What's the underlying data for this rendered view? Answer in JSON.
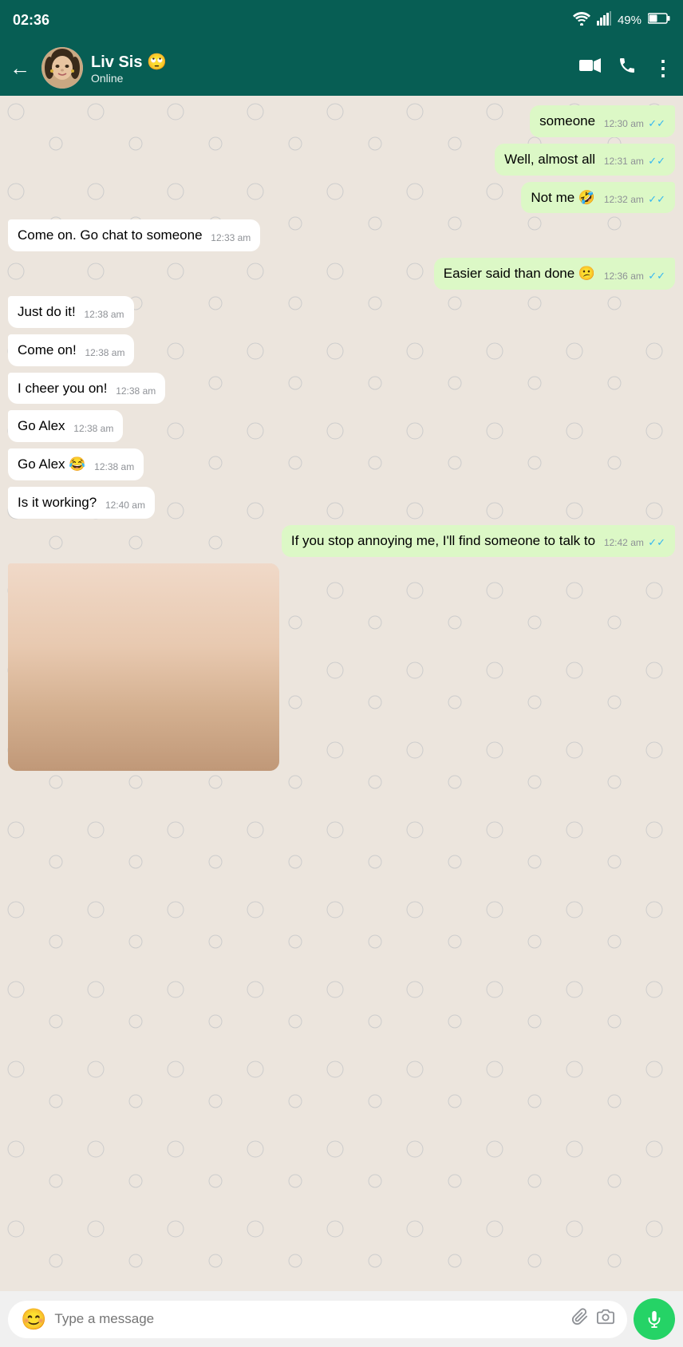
{
  "statusBar": {
    "time": "02:36",
    "battery": "49%",
    "wifi": true,
    "signal": true
  },
  "header": {
    "backLabel": "←",
    "contactName": "Liv Sis 🙄",
    "contactStatus": "Online",
    "videoCallIcon": "📹",
    "callIcon": "📞",
    "moreIcon": "⋮"
  },
  "messages": [
    {
      "id": "msg1",
      "type": "sent",
      "text": "someone",
      "time": "12:30 am",
      "ticks": "double",
      "partial": true
    },
    {
      "id": "msg2",
      "type": "sent",
      "text": "Well, almost all",
      "time": "12:31 am",
      "ticks": "double-blue"
    },
    {
      "id": "msg3",
      "type": "sent",
      "text": "Not me 🤣",
      "time": "12:32 am",
      "ticks": "double-blue"
    },
    {
      "id": "msg4",
      "type": "received",
      "text": "Come on. Go chat to someone",
      "time": "12:33 am",
      "ticks": "none"
    },
    {
      "id": "msg5",
      "type": "sent",
      "text": "Easier said than done 😕",
      "time": "12:36 am",
      "ticks": "double-blue"
    },
    {
      "id": "msg6",
      "type": "received",
      "text": "Just do it!",
      "time": "12:38 am",
      "ticks": "none"
    },
    {
      "id": "msg7",
      "type": "received",
      "text": "Come on!",
      "time": "12:38 am",
      "ticks": "none"
    },
    {
      "id": "msg8",
      "type": "received",
      "text": "I cheer you on!",
      "time": "12:38 am",
      "ticks": "none"
    },
    {
      "id": "msg9",
      "type": "received",
      "text": "Go Alex",
      "time": "12:38 am",
      "ticks": "none"
    },
    {
      "id": "msg10",
      "type": "received",
      "text": "Go Alex 😂",
      "time": "12:38 am",
      "ticks": "none"
    },
    {
      "id": "msg11",
      "type": "received",
      "text": "Is it working?",
      "time": "12:40 am",
      "ticks": "none"
    },
    {
      "id": "msg12",
      "type": "sent",
      "text": "If you stop annoying me, I'll find someone to talk to",
      "time": "12:42 am",
      "ticks": "double-blue"
    },
    {
      "id": "msg13",
      "type": "received",
      "text": "[image]",
      "time": "",
      "ticks": "none"
    }
  ],
  "inputBar": {
    "placeholder": "Type a message",
    "emojiIcon": "😊",
    "attachIcon": "📎",
    "cameraIcon": "📷",
    "micIcon": "🎤"
  }
}
